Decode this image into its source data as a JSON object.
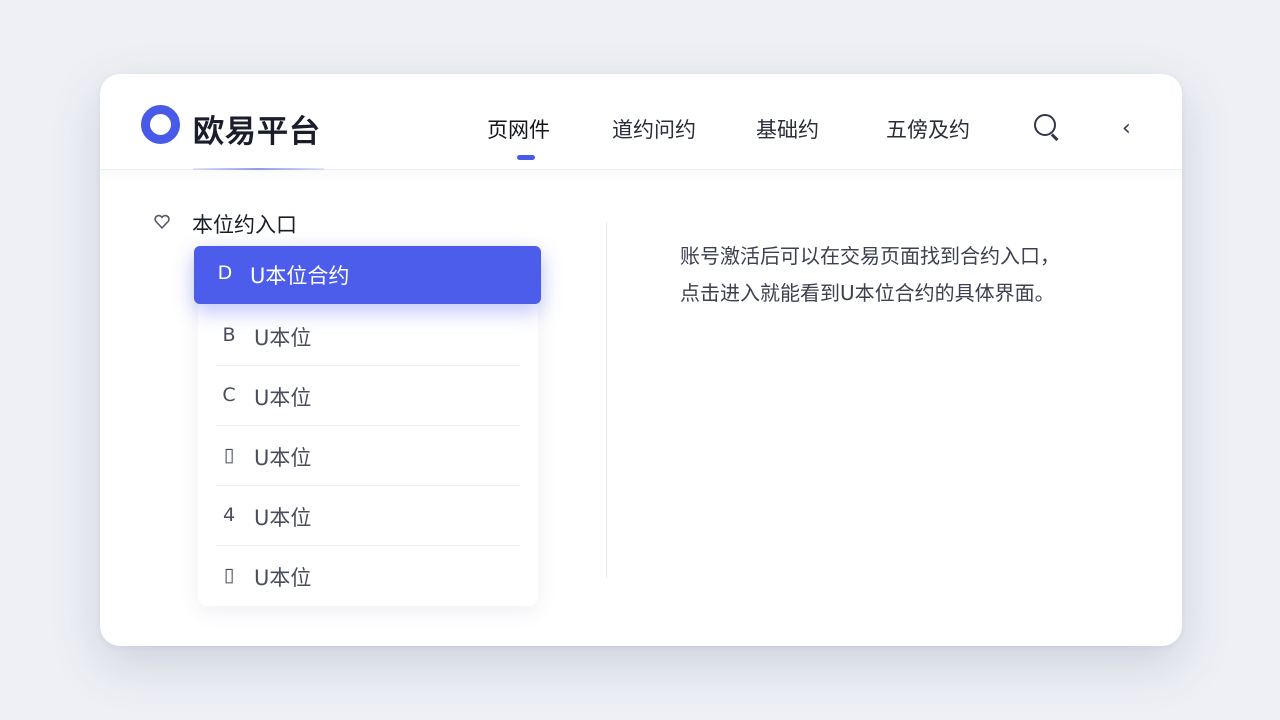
{
  "header": {
    "brand": "欧易平台",
    "tabs": [
      {
        "label": "页网件",
        "active": true
      },
      {
        "label": "道约问约",
        "active": false
      },
      {
        "label": "基础约",
        "active": false
      },
      {
        "label": "五傍及约",
        "active": false
      }
    ],
    "icons": {
      "search": "search-icon",
      "back": "chevron-left-icon"
    }
  },
  "sidebar": {
    "section_title": "本位约入口",
    "items": [
      {
        "icon": "D",
        "label": "U本位合约",
        "selected": true
      },
      {
        "icon": "B",
        "label": "U本位",
        "selected": false
      },
      {
        "icon": "C",
        "label": "U本位",
        "selected": false
      },
      {
        "icon": "▯",
        "label": "U本位",
        "selected": false
      },
      {
        "icon": "4",
        "label": "U本位",
        "selected": false
      },
      {
        "icon": "▯",
        "label": "U本位",
        "selected": false
      }
    ]
  },
  "content": {
    "description_line1": "账号激活后可以在交易页面找到合约入口，",
    "description_line2": "点击进入就能看到U本位合约的具体界面。"
  },
  "colors": {
    "accent": "#4a5ae8",
    "selected_bg": "#4d5deb",
    "background": "#eef0f5"
  }
}
